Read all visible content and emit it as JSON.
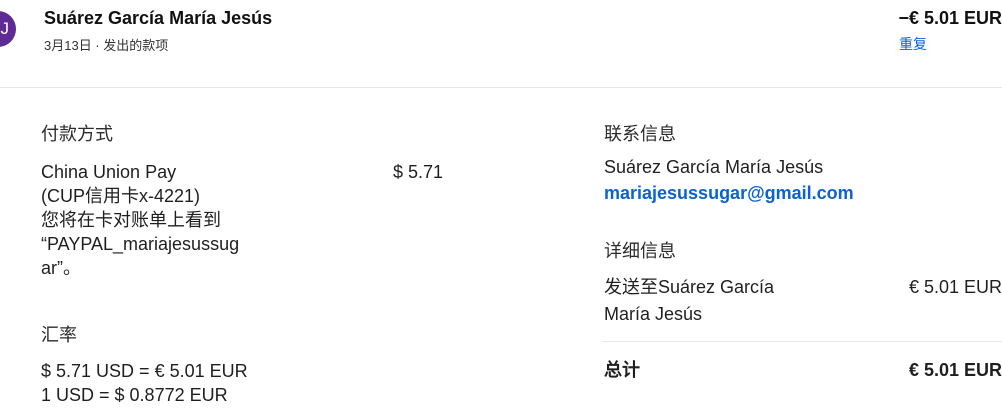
{
  "header": {
    "avatar_initial": "IJ",
    "name": "Suárez García María Jesús",
    "subtitle": "3月13日 · 发出的款项",
    "amount": "−€ 5.01 EUR",
    "repeat_label": "重复"
  },
  "payment_method": {
    "heading": "付款方式",
    "lines": [
      "China Union Pay",
      "(CUP信用卡x-4221)",
      "您将在卡对账单上看到",
      "“PAYPAL_mariajesussug",
      "ar”。"
    ],
    "amount": "$ 5.71"
  },
  "exchange": {
    "heading": "汇率",
    "line1": "$ 5.71 USD = € 5.01 EUR",
    "line2": "1 USD = $ 0.8772 EUR"
  },
  "contact": {
    "heading": "联系信息",
    "name": "Suárez García María Jesús",
    "email": "mariajesussugar@gmail.com"
  },
  "details": {
    "heading": "详细信息",
    "sent_to_line1": "发送至Suárez García",
    "sent_to_line2": "María Jesús",
    "sent_amount": "€ 5.01 EUR",
    "total_label": "总计",
    "total_amount": "€ 5.01 EUR"
  },
  "colors": {
    "accent": "#0a63d1",
    "avatar": "#5e2a96"
  }
}
